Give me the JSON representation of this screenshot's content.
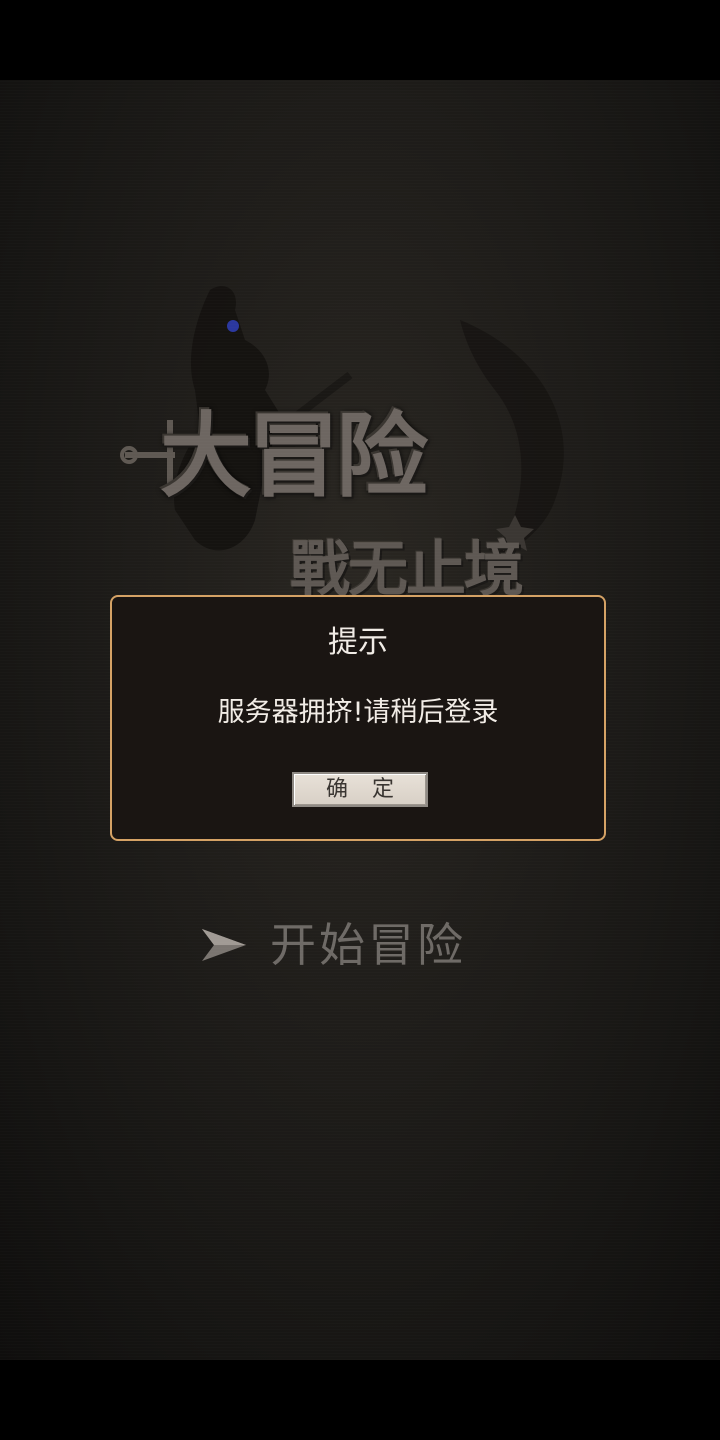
{
  "logo": {
    "title": "大冒险",
    "subtitle": "戰无止境"
  },
  "dialog": {
    "title": "提示",
    "message": "服务器拥挤!请稍后登录",
    "confirm_label": "确定"
  },
  "start": {
    "label": "开始冒险",
    "icon": "arrow-right-icon"
  },
  "colors": {
    "dialog_border": "#d5a265",
    "dialog_bg": "#1a1512",
    "dialog_text": "#f1ece6",
    "start_text": "#6e6a66"
  }
}
